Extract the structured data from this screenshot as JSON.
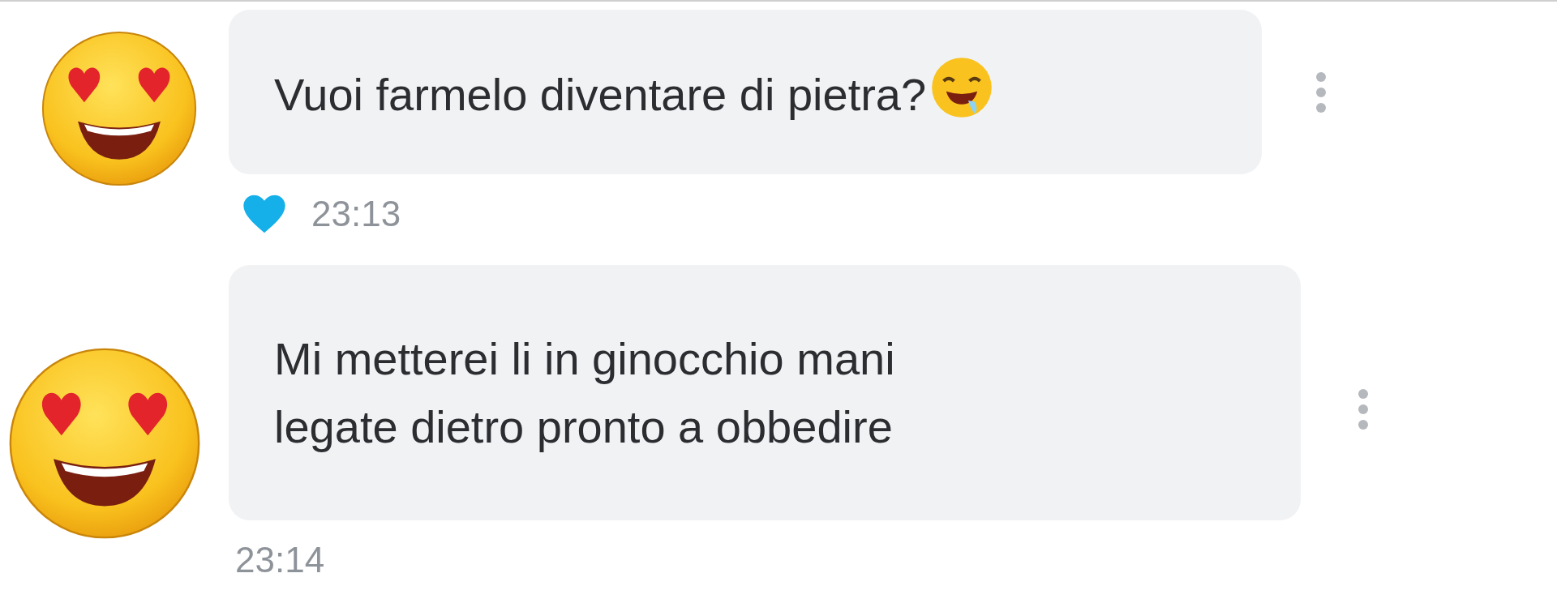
{
  "messages": [
    {
      "text": "Vuoi farmelo diventare di pietra?",
      "liked": true,
      "time": "23:13"
    },
    {
      "text": "Mi metterei li in ginocchio mani\nlegate dietro pronto a obbedire",
      "liked": false,
      "time": "23:14"
    }
  ]
}
